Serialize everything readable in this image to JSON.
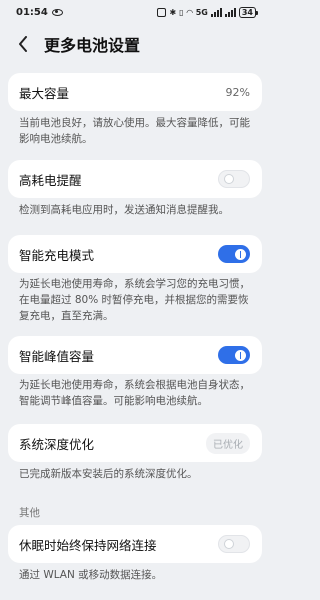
{
  "statusbar": {
    "time": "01:54",
    "network_label": "5G",
    "battery": "34"
  },
  "header": {
    "title": "更多电池设置"
  },
  "max_capacity": {
    "label": "最大容量",
    "value": "92%",
    "description": "当前电池良好，请放心使用。最大容量降低，可能影响电池续航。"
  },
  "high_drain": {
    "label": "高耗电提醒",
    "enabled": false,
    "description": "检测到高耗电应用时，发送通知消息提醒我。"
  },
  "smart_charging": {
    "label": "智能充电模式",
    "enabled": true,
    "description": "为延长电池使用寿命，系统会学习您的充电习惯，在电量超过 80% 时暂停充电，并根据您的需要恢复充电，直至充满。"
  },
  "smart_peak": {
    "label": "智能峰值容量",
    "enabled": true,
    "description": "为延长电池使用寿命，系统会根据电池自身状态，智能调节峰值容量。可能影响电池续航。"
  },
  "deep_optimization": {
    "label": "系统深度优化",
    "status": "已优化",
    "description": "已完成新版本安装后的系统深度优化。"
  },
  "other_section": {
    "title": "其他"
  },
  "sleep_network": {
    "label": "休眠时始终保持网络连接",
    "enabled": false,
    "description": "通过 WLAN 或移动数据连接。"
  },
  "colors": {
    "accent": "#2f6fe8",
    "background": "#eef0f3"
  }
}
